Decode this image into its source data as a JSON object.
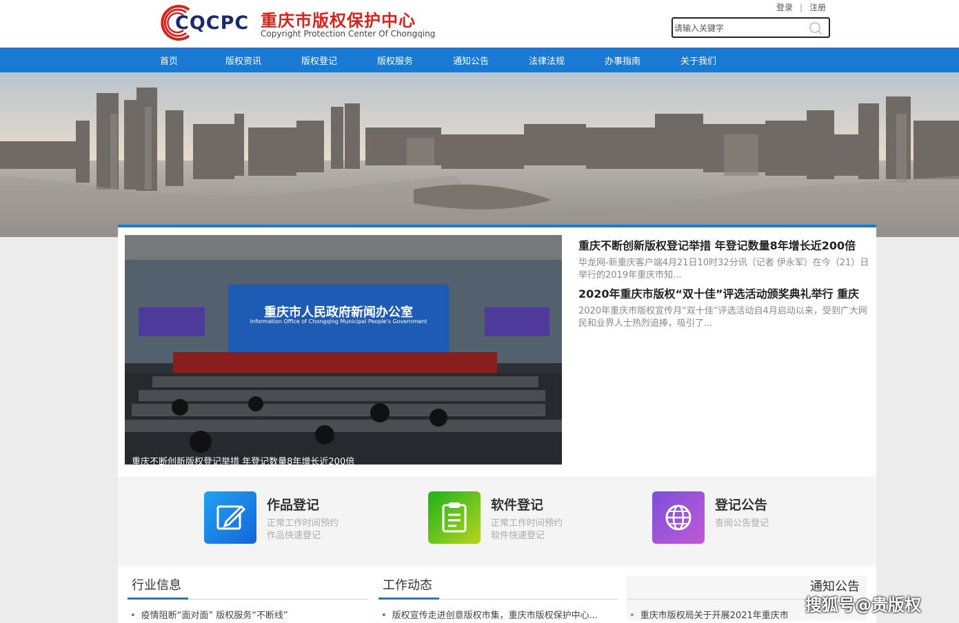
{
  "header": {
    "logo_abbr": "CQCPC",
    "logo_cn": "重庆市版权保护中心",
    "logo_en": "Copyright Protection Center Of  Chongqing",
    "login": "登录",
    "separator": "|",
    "register": "注册",
    "search_placeholder": "请输入关键字"
  },
  "nav": [
    "首页",
    "版权资讯",
    "版权登记",
    "版权服务",
    "通知公告",
    "法律法规",
    "办事指南",
    "关于我们"
  ],
  "photo": {
    "sign_cn": "重庆市人民政府新闻办公室",
    "sign_en": "Information Office of Chongqing Municipal People's Government",
    "caption": "重庆不断创新版权登记举措 年登记数量8年增长近200倍"
  },
  "news": [
    {
      "title": "重庆不断创新版权登记举措 年登记数量8年增长近200倍",
      "desc": "华龙网-新重庆客户端4月21日10时32分讯（记者 伊永军）在今（21）日举行的2019年重庆市知..."
    },
    {
      "title": "2020年重庆市版权“双十佳”评选活动颁奖典礼举行 重庆",
      "desc": "2020年重庆市版权宣传月“双十佳”评选活动自4月启动以来，受到广大网民和业界人士热烈追捧，吸引了..."
    }
  ],
  "services": [
    {
      "title": "作品登记",
      "line1": "正常工作时间预约",
      "line2": "作品快速登记",
      "color1": "#1fa3f0",
      "color2": "#1565d8",
      "icon": "edit-icon"
    },
    {
      "title": "软件登记",
      "line1": "正常工作时间预约",
      "line2": "软件快速登记",
      "color1": "#1db21d",
      "color2": "#b8d41e",
      "icon": "clipboard-icon"
    },
    {
      "title": "登记公告",
      "line1": "查阅公告登记",
      "line2": "",
      "color1": "#7b4fd8",
      "color2": "#c05ad6",
      "icon": "globe-icon"
    }
  ],
  "columns": [
    {
      "head": "行业信息",
      "item": "疫情阻断“面对面” 版权服务“不断线”"
    },
    {
      "head": "工作动态",
      "item": "版权宣传走进创意版权市集，重庆市版权保护中心..."
    },
    {
      "head": "通知公告",
      "item": "重庆市版权局关于开展2021年重庆市"
    }
  ],
  "watermark": "搜狐号@贵版权",
  "colors": {
    "nav": "#1a7ad3",
    "brand_red": "#d8231d",
    "brand_navy": "#1a2b6d"
  }
}
